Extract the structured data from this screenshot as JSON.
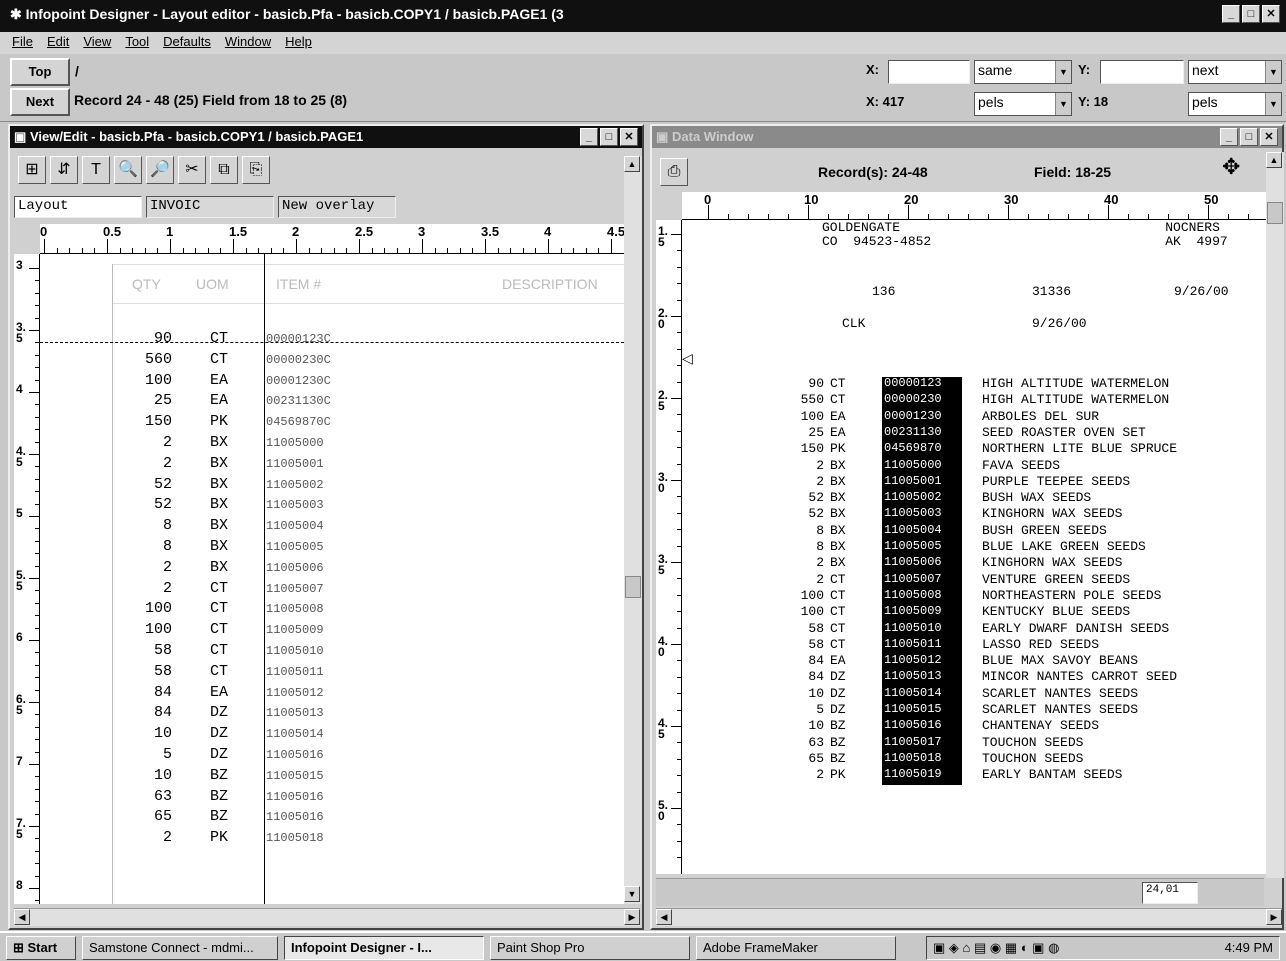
{
  "app": {
    "title": "Infopoint Designer - Layout editor - basicb.Pfa - basicb.COPY1 / basicb.PAGE1 (3",
    "win_buttons": [
      "_",
      "□",
      "✕"
    ]
  },
  "menu": [
    "File",
    "Edit",
    "View",
    "Tool",
    "Defaults",
    "Window",
    "Help"
  ],
  "cmd": {
    "top_label": "Top",
    "top_value": "/",
    "next_label": "Next",
    "next_value": "Record 24 - 48 (25) Field from 18 to 25 (8)",
    "x1_label": "X:",
    "x1_value": "",
    "x1_unit": "same",
    "y1_label": "Y:",
    "y1_value": "",
    "y1_unit": "next",
    "x2_label": "X: 417",
    "x2_value": "",
    "x2_unit": "pels",
    "y2_label": "Y: 18",
    "y2_value": "",
    "y2_unit": "pels"
  },
  "left_window": {
    "title": "View/Edit - basicb.Pfa - basicb.COPY1 / basicb.PAGE1",
    "tools": [
      "layout-tool-icon",
      "move-tool-icon",
      "text-tool-icon",
      "zoom-in-icon",
      "zoom-out-icon",
      "cut-icon",
      "copy-icon",
      "paste-icon"
    ],
    "tool_glyphs": [
      "⊞",
      "⇵",
      "T",
      "🔍",
      "🔎",
      "✂",
      "⧉",
      "⎘"
    ],
    "tabs": [
      "Layout",
      "INVOIC",
      "New overlay"
    ],
    "ruler_ticks": [
      "0",
      "0.5",
      "1",
      "1.5",
      "2",
      "2.5",
      "3",
      "3.5",
      "4",
      "4.5"
    ],
    "vruler_ticks": [
      "3",
      "3.5",
      "4",
      "4.5",
      "5",
      "5.5",
      "6",
      "6.5",
      "7",
      "7.5",
      "8"
    ],
    "headers": [
      "QTY",
      "UOM",
      "ITEM #",
      "DESCRIPTION"
    ],
    "rows": [
      [
        "90",
        "CT",
        "00000123C"
      ],
      [
        "560",
        "CT",
        "00000230C"
      ],
      [
        "100",
        "EA",
        "00001230C"
      ],
      [
        "25",
        "EA",
        "00231130C"
      ],
      [
        "150",
        "PK",
        "04569870C"
      ],
      [
        "2",
        "BX",
        "11005000"
      ],
      [
        "2",
        "BX",
        "11005001"
      ],
      [
        "52",
        "BX",
        "11005002"
      ],
      [
        "52",
        "BX",
        "11005003"
      ],
      [
        "8",
        "BX",
        "11005004"
      ],
      [
        "8",
        "BX",
        "11005005"
      ],
      [
        "2",
        "BX",
        "11005006"
      ],
      [
        "2",
        "CT",
        "11005007"
      ],
      [
        "100",
        "CT",
        "11005008"
      ],
      [
        "100",
        "CT",
        "11005009"
      ],
      [
        "58",
        "CT",
        "11005010"
      ],
      [
        "58",
        "CT",
        "11005011"
      ],
      [
        "84",
        "EA",
        "11005012"
      ],
      [
        "84",
        "DZ",
        "11005013"
      ],
      [
        "10",
        "DZ",
        "11005014"
      ],
      [
        "5",
        "DZ",
        "11005016"
      ],
      [
        "10",
        "BZ",
        "11005015"
      ],
      [
        "63",
        "BZ",
        "11005016"
      ],
      [
        "65",
        "BZ",
        "11005016"
      ],
      [
        "2",
        "PK",
        "11005018"
      ]
    ]
  },
  "right_window": {
    "title": "Data Window",
    "records_label": "Record(s): 24-48",
    "field_label": "Field: 18-25",
    "ruler_ticks": [
      "0",
      "10",
      "20",
      "30",
      "40",
      "50"
    ],
    "vruler_ticks": [
      "1.5",
      "2.0",
      "2.5",
      "3.0",
      "3.5",
      "4.0",
      "4.5",
      "5.0"
    ],
    "header_lines": [
      "GOLDENGATE                                  NOCNERS",
      "CO  94523-4852                              AK  4997"
    ],
    "info_line1": [
      "136",
      "31336",
      "9/26/00"
    ],
    "info_line2": [
      "CLK",
      "9/26/00"
    ],
    "rows": [
      [
        "90",
        "CT",
        "00000123",
        "HIGH ALTITUDE WATERMELON"
      ],
      [
        "550",
        "CT",
        "00000230",
        "HIGH ALTITUDE WATERMELON"
      ],
      [
        "100",
        "EA",
        "00001230",
        "ARBOLES DEL SUR"
      ],
      [
        "25",
        "EA",
        "00231130",
        "SEED ROASTER OVEN SET"
      ],
      [
        "150",
        "PK",
        "04569870",
        "NORTHERN LITE BLUE SPRUCE"
      ],
      [
        "2",
        "BX",
        "11005000",
        "FAVA SEEDS"
      ],
      [
        "2",
        "BX",
        "11005001",
        "PURPLE TEEPEE SEEDS"
      ],
      [
        "52",
        "BX",
        "11005002",
        "BUSH WAX SEEDS"
      ],
      [
        "52",
        "BX",
        "11005003",
        "KINGHORN WAX SEEDS"
      ],
      [
        "8",
        "BX",
        "11005004",
        "BUSH GREEN SEEDS"
      ],
      [
        "8",
        "BX",
        "11005005",
        "BLUE LAKE GREEN SEEDS"
      ],
      [
        "2",
        "BX",
        "11005006",
        "KINGHORN WAX SEEDS"
      ],
      [
        "2",
        "CT",
        "11005007",
        "VENTURE GREEN SEEDS"
      ],
      [
        "100",
        "CT",
        "11005008",
        "NORTHEASTERN POLE SEEDS"
      ],
      [
        "100",
        "CT",
        "11005009",
        "KENTUCKY BLUE SEEDS"
      ],
      [
        "58",
        "CT",
        "11005010",
        "EARLY DWARF DANISH SEEDS"
      ],
      [
        "58",
        "CT",
        "11005011",
        "LASSO RED SEEDS"
      ],
      [
        "84",
        "EA",
        "11005012",
        "BLUE MAX SAVOY BEANS"
      ],
      [
        "84",
        "DZ",
        "11005013",
        "MINCOR NANTES CARROT SEED"
      ],
      [
        "10",
        "DZ",
        "11005014",
        "SCARLET NANTES SEEDS"
      ],
      [
        "5",
        "DZ",
        "11005015",
        "SCARLET NANTES SEEDS"
      ],
      [
        "10",
        "BZ",
        "11005016",
        "CHANTENAY SEEDS"
      ],
      [
        "63",
        "BZ",
        "11005017",
        "TOUCHON SEEDS"
      ],
      [
        "65",
        "BZ",
        "11005018",
        "TOUCHON SEEDS"
      ],
      [
        "2",
        "PK",
        "11005019",
        "EARLY BANTAM SEEDS"
      ]
    ],
    "status_box": "24,01"
  },
  "taskbar": {
    "start": "Start",
    "tasks": [
      "Samstone Connect - mdmi...",
      "Infopoint Designer - I...",
      "Paint Shop Pro",
      "Adobe FrameMaker"
    ],
    "clock": "4:49 PM"
  }
}
